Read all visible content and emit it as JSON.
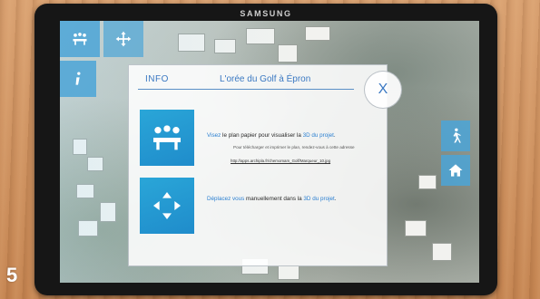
{
  "device": {
    "brand": "SAMSUNG"
  },
  "step": {
    "number": "5"
  },
  "toolbar": {
    "buttons": [
      {
        "icon": "meeting-icon"
      },
      {
        "icon": "move-arrows-icon"
      },
      {
        "icon": "info-icon"
      }
    ],
    "side_buttons": [
      {
        "icon": "walk-icon"
      },
      {
        "icon": "home-icon"
      }
    ]
  },
  "panel": {
    "info_label": "INFO",
    "title": "L'orée du Golf à Épron",
    "close_label": "X",
    "item1": {
      "part1": "Visez",
      "part2": " le plan papier pour visualiser la ",
      "part3": "3D du projet",
      "part4": ".",
      "sub": "Pour télécharger et imprimer le plan, rendez-vous à cette adresse",
      "link": "http://apps.archipla.fr/chemomam_Golf/Marqueur_10.jpg"
    },
    "item2": {
      "part1": "Déplacez vous",
      "part2": " manuellement dans la ",
      "part3": "3D du projet",
      "part4": "."
    }
  },
  "colors": {
    "accent": "#3a78c2",
    "tile": "#1f8ccb"
  }
}
